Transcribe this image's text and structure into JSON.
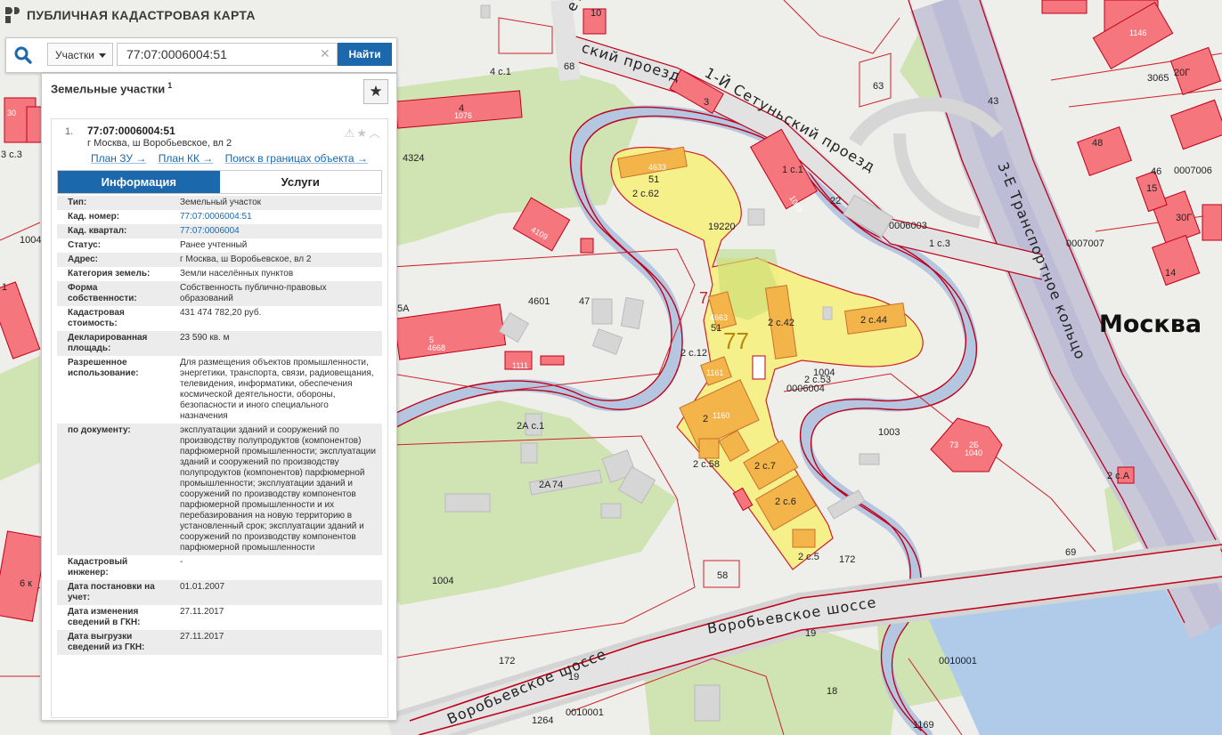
{
  "app": {
    "title": "ПУБЛИЧНАЯ КАДАСТРОВАЯ КАРТА"
  },
  "search": {
    "type_label": "Участки",
    "query": "77:07:0006004:51",
    "find_label": "Найти"
  },
  "panel": {
    "header": "Земельные участки",
    "count": "1",
    "result": {
      "index": "1.",
      "number": "77:07:0006004:51",
      "address": "г Москва, ш Воробьевское, вл 2",
      "links": [
        "План ЗУ →",
        "План КК →",
        "Поиск в границах объекта →"
      ],
      "tabs": [
        "Информация",
        "Услуги"
      ]
    },
    "info": [
      {
        "label": "Тип:",
        "value": "Земельный участок"
      },
      {
        "label": "Кад. номер:",
        "value": "77:07:0006004:51"
      },
      {
        "label": "Кад. квартал:",
        "value": "77:07:0006004"
      },
      {
        "label": "Статус:",
        "value": "Ранее учтенный"
      },
      {
        "label": "Адрес:",
        "value": "г Москва, ш Воробьевское, вл 2"
      },
      {
        "label": "Категория земель:",
        "value": "Земли населённых пунктов"
      },
      {
        "label": "Форма собственности:",
        "value": "Собственность публично-правовых образований"
      },
      {
        "label": "Кадастровая стоимость:",
        "value": "431 474 782,20 руб."
      },
      {
        "label": "Декларированная площадь:",
        "value": "23 590 кв. м"
      },
      {
        "label": "Разрешенное использование:",
        "value": "Для размещения объектов промышленности, энергетики, транспорта, связи, радиовещания, телевидения, информатики, обеспечения космической деятельности, обороны, безопасности и иного специального назначения"
      },
      {
        "label": "по документу:",
        "value": "эксплуатации зданий и сооружений по производству полупродуктов (компонентов) парфюмерной промышленности; эксплуатации зданий и сооружений по производству полупродуктов (компонентов) парфюмерной промышленности; эксплуатации зданий и сооружений по производству компонентов парфюмерной промышленности и их перебазирования на новую территорию в установленный срок; эксплуатации зданий и сооружений по производству компонентов парфюмерной промышленности"
      },
      {
        "label": "Кадастровый инженер:",
        "value": "-"
      },
      {
        "label": "Дата постановки на учет:",
        "value": "01.01.2007"
      },
      {
        "label": "Дата изменения сведений в ГКН:",
        "value": "27.11.2017"
      },
      {
        "label": "Дата выгрузки сведений из ГКН:",
        "value": "27.11.2017"
      }
    ]
  },
  "map": {
    "city_label": "Москва",
    "streets": {
      "ring": "3-Е Транспортное кольцо",
      "vorob_1": "Воробьевское шоссе",
      "vorob_2": "Воробьевское шоссе",
      "setun_1": "1-й Сетуньский проезд",
      "setun_2": "1-Й Сетуньский проезд",
      "setun_3": "ский проезд",
      "setun_4": "етуньски"
    },
    "labels": {
      "l4324": "4324",
      "l4601": "4601",
      "l47": "47",
      "l4s1": "4 с.1",
      "l4": "4",
      "l1076": "1076",
      "l3": "3",
      "l1s1": "1 с.1",
      "l22": "22",
      "l0006003": "0006003",
      "l1s3": "1 с.3",
      "l0007007": "0007007",
      "l0007006": "0007006",
      "l46": "46",
      "l48": "48",
      "l43": "43",
      "l30g": "30Г",
      "l20g": "20Г",
      "l3065": "3065",
      "l1146": "1146",
      "l63": "63",
      "l19220": "19220",
      "l2s62": "2 с.62",
      "l2s42": "2 с.42",
      "l2s44": "2 с.44",
      "l2s12": "2 с.12",
      "l2s53": "2 с.53",
      "l0006004": "0006004",
      "l1004a": "1004",
      "l2": "2",
      "l2s58": "2 с.58",
      "l2s7": "2 с.7",
      "l2s6": "2 с.6",
      "l2s5": "2 с.5",
      "l77": "77",
      "l7": "7",
      "l172a": "172",
      "l172b": "172",
      "l1003": "1003",
      "l73": "73",
      "l2b": "2Б",
      "l1040": "1040",
      "l2sa": "2 с.А",
      "l69": "69",
      "l2as1": "2А с.1",
      "l2a": "2А",
      "l74": "74",
      "l58": "58",
      "l1004b": "1004",
      "l1004c": "1004",
      "l0010001a": "0010001",
      "l0010001b": "0010001",
      "l1264": "1264",
      "l1169": "1169",
      "l18": "18",
      "l19a": "19",
      "l19b": "19",
      "l5": "5",
      "l4668": "4668",
      "l1111": "1111",
      "l6": "6 к",
      "l1": "1",
      "l30": "30",
      "l3s3": "3 с.3",
      "l10": "10",
      "l1085": "1085",
      "l68": "68",
      "l61": "61",
      "l14": "14",
      "l15": "15",
      "l4633": "4633",
      "l51a": "51",
      "l51b": "51",
      "l4663": "4663",
      "l1161": "1161",
      "l1160": "1160",
      "l1093": "1093",
      "l4109": "4109",
      "l5a": "5А"
    }
  }
}
